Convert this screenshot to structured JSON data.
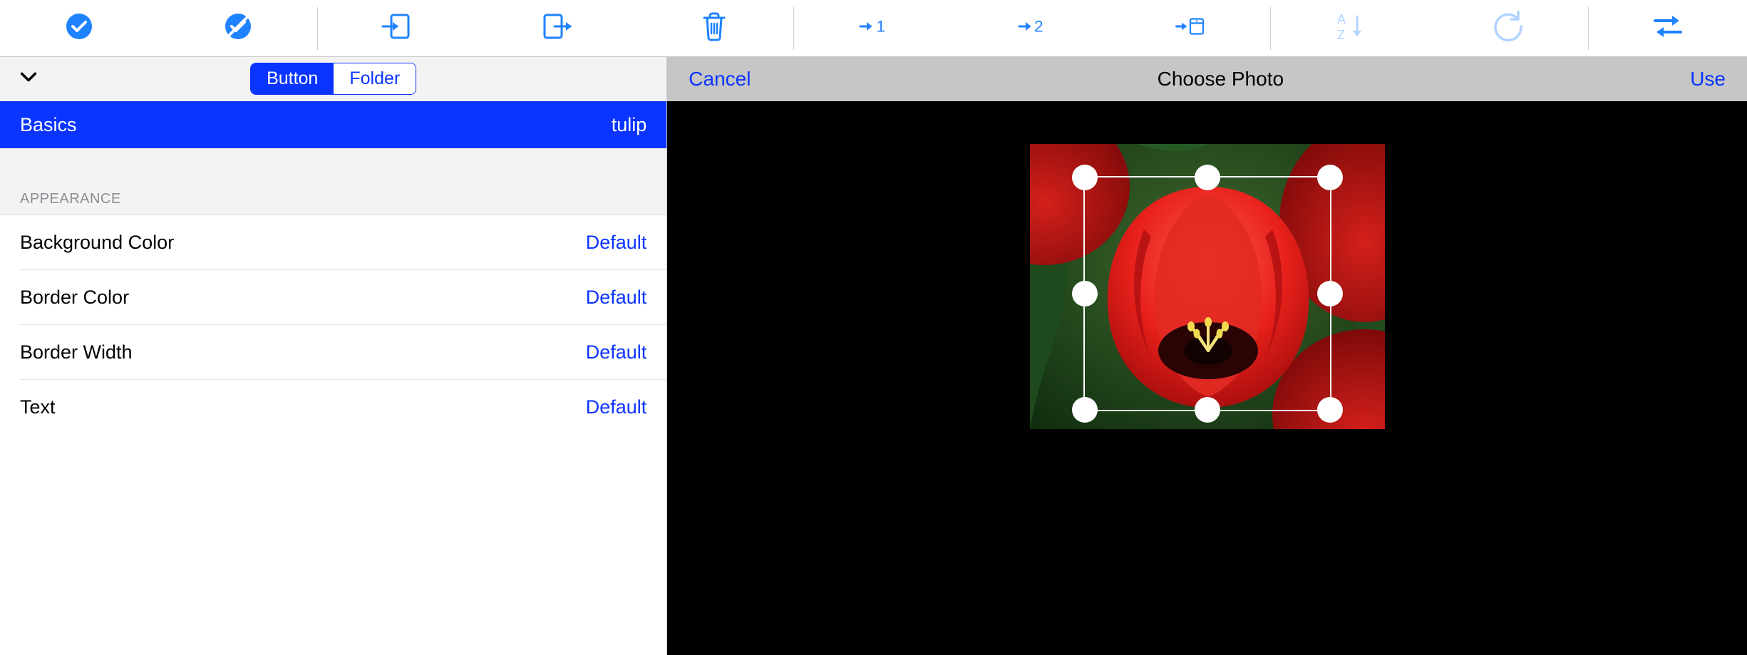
{
  "toolbar": {
    "items": [
      {
        "name": "check-solid-icon"
      },
      {
        "name": "check-x-solid-icon"
      },
      {
        "name": "import-icon"
      },
      {
        "name": "export-icon"
      },
      {
        "name": "trash-icon"
      },
      {
        "name": "arrow-to-1-icon"
      },
      {
        "name": "arrow-to-2-icon"
      },
      {
        "name": "arrow-to-box-icon"
      },
      {
        "name": "sort-az-icon"
      },
      {
        "name": "refresh-icon"
      },
      {
        "name": "swap-arrows-icon"
      }
    ]
  },
  "left_pane": {
    "segmented": {
      "button_label": "Button",
      "folder_label": "Folder",
      "active": "button"
    },
    "basics": {
      "label": "Basics",
      "value": "tulip"
    },
    "appearance": {
      "header": "APPEARANCE",
      "rows": [
        {
          "label": "Background Color",
          "value": "Default"
        },
        {
          "label": "Border Color",
          "value": "Default"
        },
        {
          "label": "Border Width",
          "value": "Default"
        },
        {
          "label": "Text",
          "value": "Default"
        }
      ]
    }
  },
  "right_pane": {
    "cancel_label": "Cancel",
    "title": "Choose Photo",
    "use_label": "Use"
  },
  "colors": {
    "ios_blue": "#0a34ff",
    "toolbar_blue": "#1f82ff"
  }
}
